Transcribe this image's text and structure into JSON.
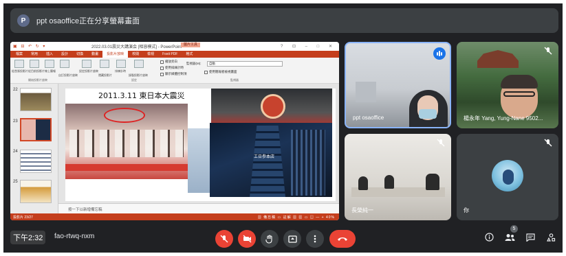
{
  "banner": {
    "avatar_letter": "P",
    "text": "ppt osaoffice正在分享螢幕畫面"
  },
  "presentation": {
    "title_bar": {
      "quick_access": "▣ ⊟ ↶ ↻ ▾",
      "document": "2022.03.01震災大講演会 [相容模式] - PowerPoint",
      "context_tab": "圖片工具",
      "window_controls": "? ⊡ – □ ✕"
    },
    "tabs": [
      "檔案",
      "常用",
      "插入",
      "設計",
      "切換",
      "動畫",
      "投影片放映",
      "校閱",
      "檢視",
      "Foxit PDF",
      "格式"
    ],
    "active_tab": "投影片放映",
    "ribbon": {
      "buttons": [
        "從首張投影片",
        "從目前投影片",
        "線上簡報",
        "自訂投影片放映",
        "設定投影片放映",
        "隱藏投影片",
        "排練計時",
        "錄製投影片放映"
      ],
      "groups": [
        "開始投影片放映",
        "設定",
        "監視器"
      ],
      "checks": [
        "播放旁白",
        "使用排練計時",
        "顯示媒體控制項"
      ],
      "monitor_label": "監視器(M):",
      "monitor_value": "自動",
      "presenter_view": "使用簡報者檢視畫面"
    },
    "thumbnails": [
      {
        "num": "22",
        "selected": false
      },
      {
        "num": "23",
        "selected": true
      },
      {
        "num": "24",
        "selected": false
      },
      {
        "num": "25",
        "selected": false
      }
    ],
    "slide": {
      "title": "2011.3.11 東日本大震災",
      "building_sign": "工日参本店"
    },
    "notes_placeholder": "按一下以新增備忘稿",
    "status_left": "投影片 23/27",
    "status_right": "▦ 備忘稿  ▭ 註解  ▦ ▦ ▭ ▤ — + 40%"
  },
  "tiles": [
    {
      "name": "ppt osaoffice",
      "speaking": true
    },
    {
      "name": "楊永年 Yang, Yung-Nane 9502...",
      "muted": true
    },
    {
      "name": "長榮純一",
      "muted": true
    },
    {
      "name": "你",
      "muted": true
    }
  ],
  "bottom": {
    "time": "下午2:32",
    "meeting_code": "fao-rtwq-nxm",
    "participants_count": "5",
    "icons": [
      "mic-off-icon",
      "camera-off-icon",
      "raise-hand-icon",
      "present-icon",
      "more-icon",
      "hangup-icon",
      "info-icon",
      "people-icon",
      "chat-icon",
      "activities-icon"
    ]
  },
  "colors": {
    "meet_bg": "#202124",
    "tile_bg": "#3c4043",
    "danger": "#ea4335",
    "accent": "#1a73e8",
    "ppt_accent": "#c43e1c"
  }
}
